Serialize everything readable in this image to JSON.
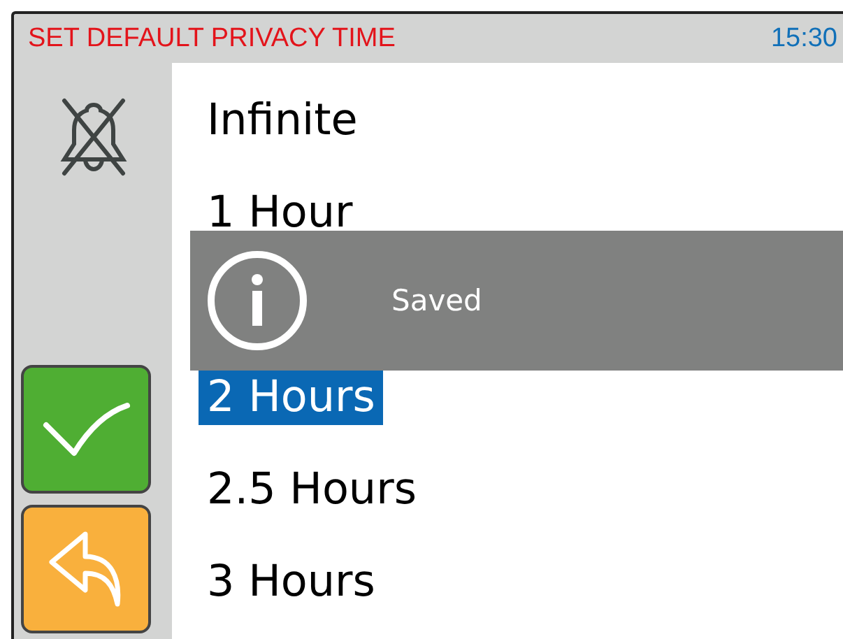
{
  "header": {
    "title": "SET DEFAULT PRIVACY TIME",
    "time": "15:30"
  },
  "list": [
    {
      "kind": "option",
      "label": "Infinite",
      "selected": false
    },
    {
      "kind": "option",
      "label": "1 Hour",
      "selected": false
    },
    {
      "kind": "toast",
      "message": "Saved"
    },
    {
      "kind": "option",
      "label": "2 Hours",
      "selected": true
    },
    {
      "kind": "option",
      "label": "2.5 Hours",
      "selected": false
    },
    {
      "kind": "option",
      "label": "3 Hours",
      "selected": false
    }
  ]
}
